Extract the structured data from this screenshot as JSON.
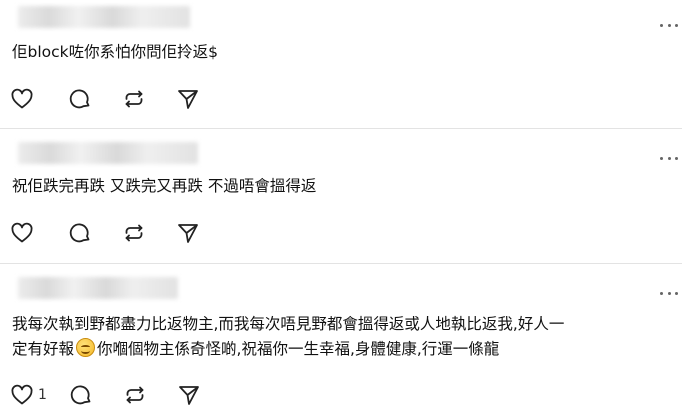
{
  "posts": [
    {
      "text": "佢block咗你系怕你問佢拎返$",
      "like_count": ""
    },
    {
      "text": "祝佢跌完再跌 又跌完又再跌 不過唔會搵得返",
      "like_count": ""
    },
    {
      "text_line1": "我每次執到野都盡力比返物主,而我每次唔見野都會搵得返或人地執比返我,好人一",
      "text_line2a": "定有好報",
      "text_line2b": "你嗰個物主係奇怪啲,祝福你一生幸福,身體健康,行運一條龍",
      "like_count": "1"
    }
  ],
  "icons": {
    "like": "heart-icon",
    "reply": "comment-bubble-icon",
    "repost": "repost-icon",
    "share": "send-icon",
    "more": "more-dots-icon",
    "emoji": "smiling-face-emoji"
  }
}
